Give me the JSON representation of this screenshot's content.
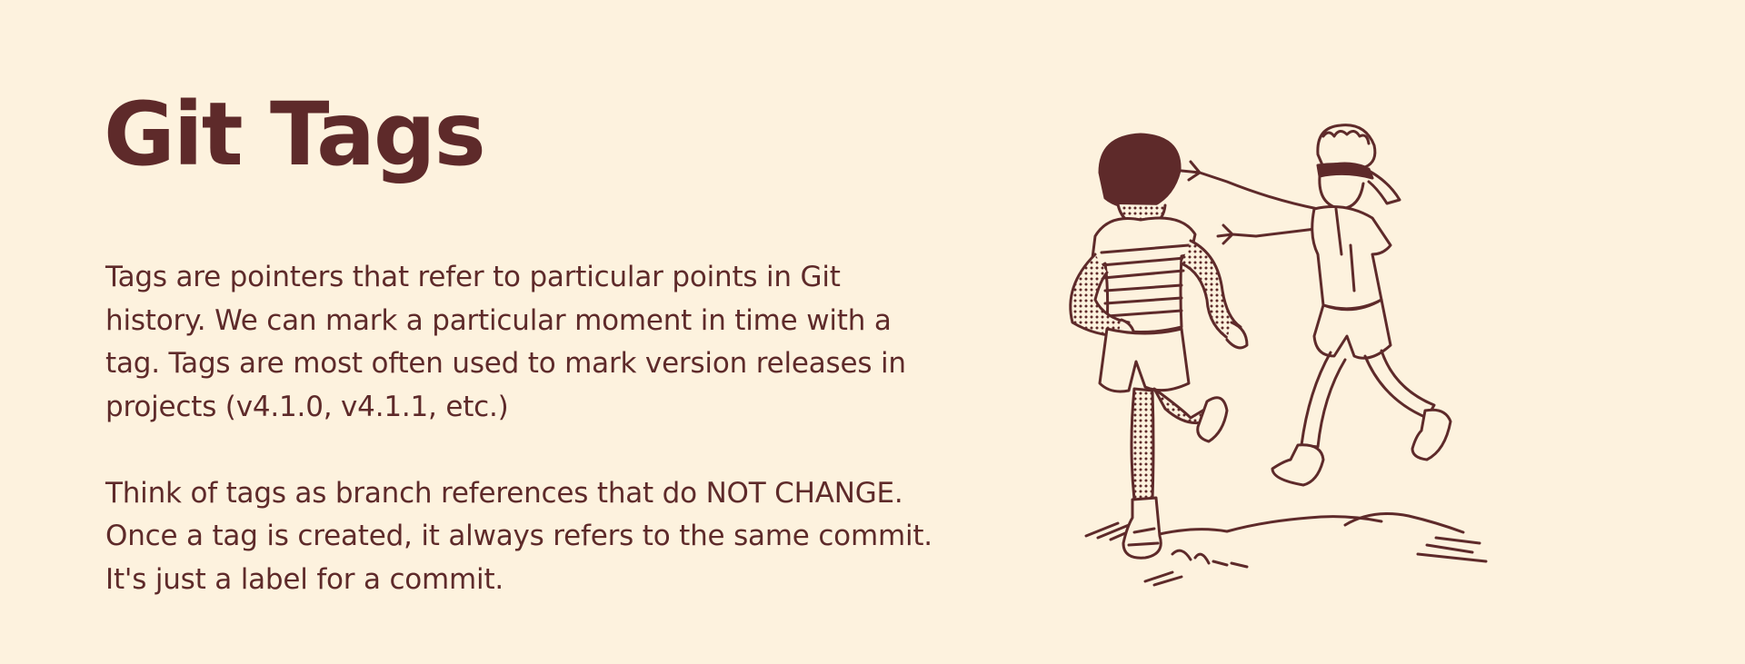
{
  "slide": {
    "title": "Git Tags",
    "paragraphs": [
      {
        "lines": [
          "Tags are pointers that refer to particular points in Git",
          "history.  We can mark a particular moment in time with a",
          "tag.  Tags are most often used to mark version releases in",
          "projects (v4.1.0, v4.1.1, etc.)"
        ]
      },
      {
        "lines": [
          "Think of tags as branch references that do NOT CHANGE.",
          "Once a tag is created, it always refers to the same commit.",
          "It's just a label for a commit."
        ]
      }
    ],
    "illustration_icon": "children-playing-blindfold-illustration",
    "colors": {
      "background": "#fdf2de",
      "ink": "#5e2a2a"
    }
  }
}
